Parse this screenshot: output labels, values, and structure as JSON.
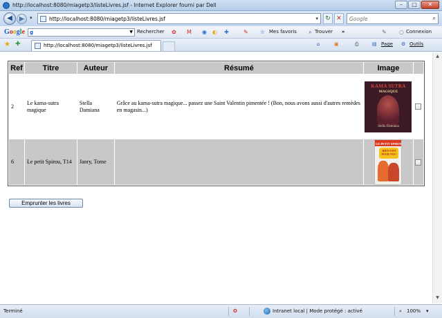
{
  "window": {
    "title": "http://localhost:8080/miagetp3/listeLivres.jsf - Internet Explorer fourni par Dell",
    "minimize": "–",
    "maximize": "□",
    "close": "✕"
  },
  "nav": {
    "address_url": "http://localhost:8080/miagetp3/listeLivres.jsf",
    "search_placeholder": "Google"
  },
  "google_toolbar": {
    "logo_parts": [
      "G",
      "o",
      "o",
      "g",
      "l",
      "e"
    ],
    "search_prefix": "g",
    "rechercher": "Rechercher",
    "favoris": "Mes favoris",
    "trouver": "Trouver",
    "more": "»",
    "connexion": "Connexion"
  },
  "tabs": {
    "active_label": "http://localhost:8080/miagetp3/listeLivres.jsf",
    "page_menu": "Page",
    "tools_menu": "Outils"
  },
  "table": {
    "headers": [
      "Ref",
      "Titre",
      "Auteur",
      "Résumé",
      "Image"
    ],
    "rows": [
      {
        "ref": "2",
        "titre": "Le kama-sutra magique",
        "auteur": "Stella Damiana",
        "resume": "Grâce au kama-sutra magique... passez une Saint Valentin pimentée ! (Bon, nous avons aussi d'autres remèdes en magasin...)",
        "cover": {
          "line1": "KAMA SUTRA",
          "line2": "MAGIQUE",
          "author": "Stella Damiana"
        }
      },
      {
        "ref": "6",
        "titre": "Le petit Spirou, T14",
        "auteur": "Janry, Tome",
        "resume": "",
        "cover": {
          "line1": "LE PETIT SPIROU",
          "line2": "BIEN FAIT POUR TOI !"
        }
      }
    ]
  },
  "borrow_button": "Emprunter les livres",
  "status": {
    "left": "Terminé",
    "zone": "Intranet local | Mode protégé : activé",
    "zoom": "100%"
  },
  "colors": {
    "header_bg": "#c8c8c8",
    "alt_row_bg": "#c8c8c8",
    "chrome_blue": "#c3d6ee"
  }
}
